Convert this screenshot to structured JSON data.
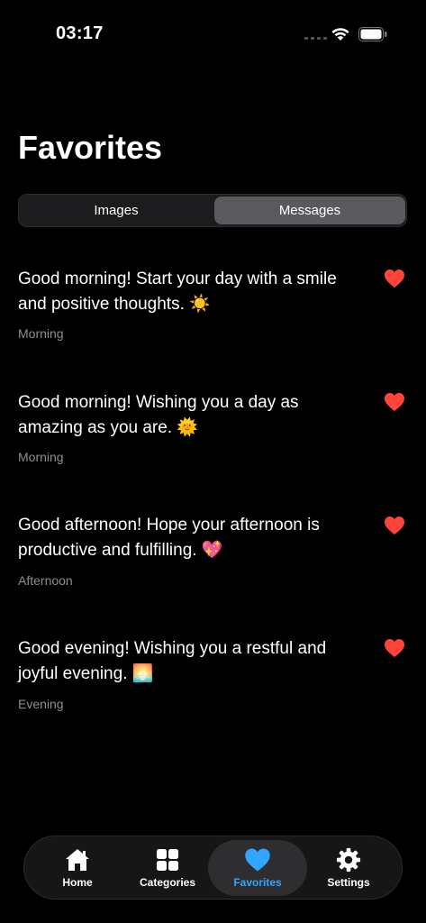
{
  "status_bar": {
    "time": "03:17"
  },
  "page": {
    "title": "Favorites"
  },
  "segments": [
    {
      "label": "Images",
      "selected": false
    },
    {
      "label": "Messages",
      "selected": true
    }
  ],
  "messages": [
    {
      "text": "Good morning! Start your day with a smile and positive thoughts. ☀️",
      "category": "Morning",
      "favorited": true
    },
    {
      "text": "Good morning! Wishing you a day as amazing as you are. 🌞",
      "category": "Morning",
      "favorited": true
    },
    {
      "text": "Good afternoon! Hope your afternoon is productive and fulfilling. 💖",
      "category": "Afternoon",
      "favorited": true
    },
    {
      "text": "Good evening! Wishing you a restful and joyful evening. 🌅",
      "category": "Evening",
      "favorited": true
    }
  ],
  "tabs": [
    {
      "label": "Home",
      "icon": "house-icon",
      "active": false
    },
    {
      "label": "Categories",
      "icon": "grid-icon",
      "active": false
    },
    {
      "label": "Favorites",
      "icon": "heart-icon",
      "active": true
    },
    {
      "label": "Settings",
      "icon": "gear-icon",
      "active": false
    }
  ],
  "colors": {
    "heart": "#ff453a",
    "accent": "#2fa6ff",
    "background": "#000000",
    "secondary_text": "#8e8e93"
  }
}
